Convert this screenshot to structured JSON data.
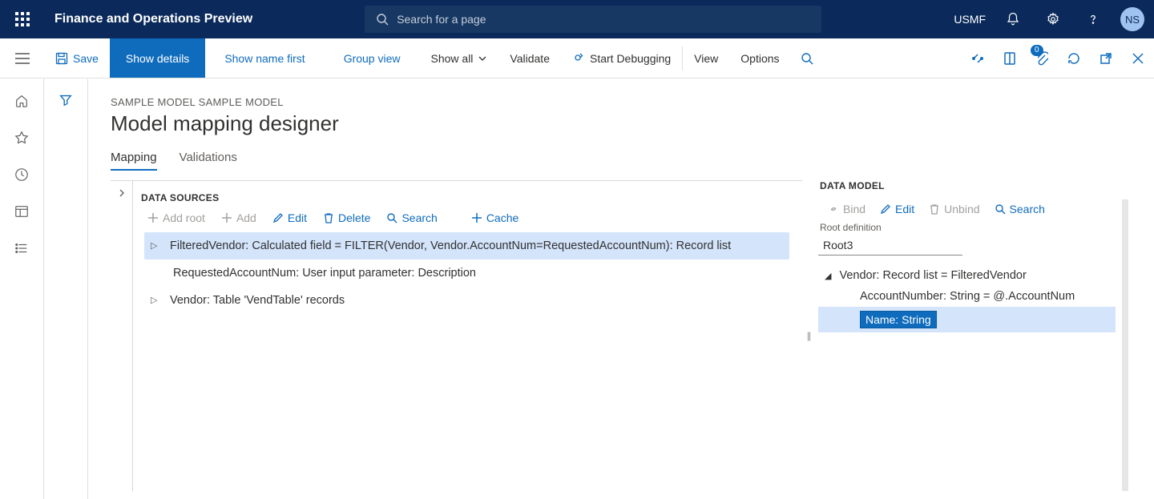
{
  "topnav": {
    "app_title": "Finance and Operations Preview",
    "search_placeholder": "Search for a page",
    "company": "USMF",
    "user_initials": "NS"
  },
  "cmdbar": {
    "save": "Save",
    "show_details": "Show details",
    "show_name_first": "Show name first",
    "group_view": "Group view",
    "show_all": "Show all",
    "validate": "Validate",
    "start_debugging": "Start Debugging",
    "view": "View",
    "options": "Options",
    "attachments_count": "0"
  },
  "page": {
    "breadcrumb": "SAMPLE MODEL SAMPLE MODEL",
    "title": "Model mapping designer",
    "tabs": {
      "mapping": "Mapping",
      "validations": "Validations"
    }
  },
  "data_sources": {
    "heading": "DATA SOURCES",
    "toolbar": {
      "add_root": "Add root",
      "add": "Add",
      "edit": "Edit",
      "delete": "Delete",
      "search": "Search",
      "cache": "Cache"
    },
    "rows": {
      "r1": "FilteredVendor: Calculated field = FILTER(Vendor, Vendor.AccountNum=RequestedAccountNum): Record list",
      "r2": "RequestedAccountNum: User input parameter: Description",
      "r3": "Vendor: Table 'VendTable' records"
    }
  },
  "data_model": {
    "heading": "DATA MODEL",
    "toolbar": {
      "bind": "Bind",
      "edit": "Edit",
      "unbind": "Unbind",
      "search": "Search"
    },
    "root_label": "Root definition",
    "root_value": "Root3",
    "rows": {
      "vendor": "Vendor: Record list = FilteredVendor",
      "account": "AccountNumber: String = @.AccountNum",
      "name": "Name: String"
    }
  }
}
